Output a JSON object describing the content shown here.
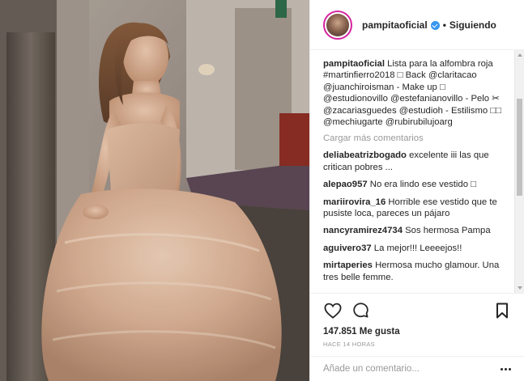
{
  "post": {
    "photo_icon": "photo"
  },
  "header": {
    "username": "pampitaoficial",
    "separator": "•",
    "follow_status": "Siguiendo",
    "verified_icon": "verified-badge-icon"
  },
  "caption": {
    "username": "pampitaoficial",
    "text": "Lista para la alfombra roja #martinfierro2018 □ Back @claritacao @juanchiroisman - Make up □ @estudionovillo @estefanianovillo - Pelo ✂ @zacariasguedes @estudioh - Estilismo □□ @mechiugarte @rubirubilujoarg"
  },
  "load_more": "Cargar más comentarios",
  "comments": [
    {
      "user": "deliabeatrizbogado",
      "text": "excelente iii las que critican pobres ..."
    },
    {
      "user": "alepao957",
      "text": "No era lindo ese vestido □"
    },
    {
      "user": "mariirovira_16",
      "text": "Horrible ese vestido que te pusiste loca, pareces un pájaro"
    },
    {
      "user": "nancyramirez4734",
      "text": "Sos hermosa Pampa"
    },
    {
      "user": "aguivero37",
      "text": "La mejor!!! Leeeejos!!"
    },
    {
      "user": "mirtaperies",
      "text": "Hermosa mucho glamour. Una tres belle femme."
    }
  ],
  "actions": {
    "like_icon": "heart-icon",
    "comment_icon": "comment-icon",
    "save_icon": "bookmark-icon"
  },
  "likes_text": "147.851 Me gusta",
  "time_text": "HACE 14 HORAS",
  "add_comment": {
    "placeholder": "Añade un comentario...",
    "more_icon": "more-options-icon"
  },
  "colors": {
    "verified": "#3897f0",
    "avatar_ring": "#d6249f",
    "muted_text": "#999999",
    "text": "#262626"
  }
}
